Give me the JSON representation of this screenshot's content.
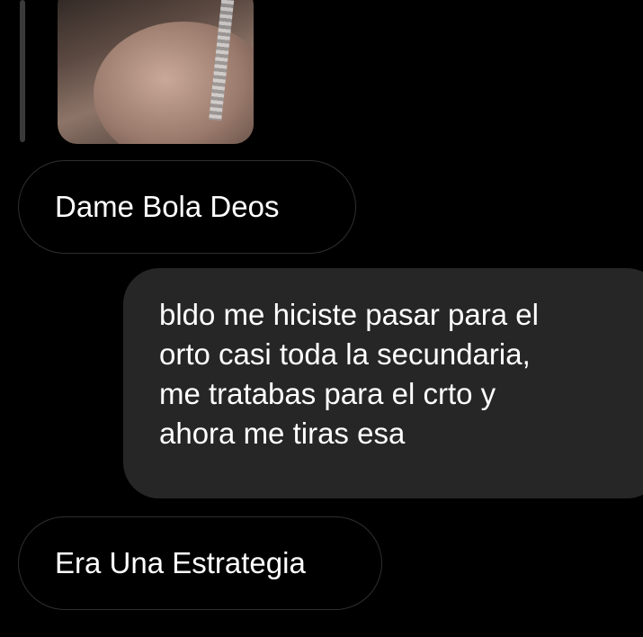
{
  "conversation": {
    "messages": [
      {
        "direction": "received",
        "text": "Dame Bola Deos"
      },
      {
        "direction": "sent",
        "lines": [
          "bldo me hiciste pasar para el",
          "orto casi toda la secundaria,",
          "me tratabas para el crto y",
          "ahora me tiras esa"
        ]
      },
      {
        "direction": "received",
        "text": "Era Una Estrategia"
      }
    ]
  },
  "colors": {
    "background": "#000000",
    "sent_bubble": "#262626",
    "received_border": "#2f2f2f",
    "text": "#ffffff"
  }
}
